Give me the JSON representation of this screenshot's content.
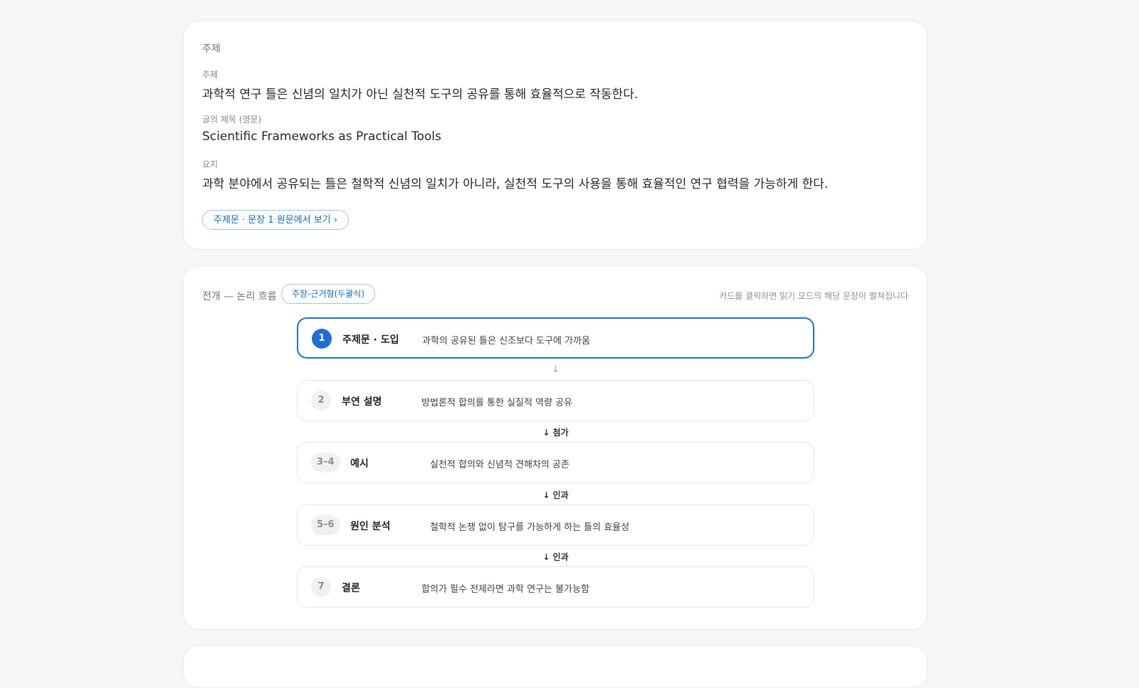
{
  "theme_section": {
    "section_title": "주제",
    "topic_label": "주제",
    "topic_value": "과학적 연구 틀은 신념의 일치가 아닌 실천적 도구의 공유를 통해 효율적으로 작동한다.",
    "title_label": "글의 제목 (영문)",
    "title_value": "Scientific Frameworks as Practical Tools",
    "gist_label": "요지",
    "gist_value": "과학 분야에서 공유되는 틀은 철학적 신념의 일치가 아니라, 실천적 도구의 사용을 통해 효율적인 연구 협력을 가능하게 한다.",
    "view_link": "주제문 · 문장 1 원문에서 보기 ›"
  },
  "flow_section": {
    "section_title": "전개 — 논리 흐름",
    "structure_badge": "주장-근거형(두괄식)",
    "hint": "카드를 클릭하면 읽기 모드의 해당 문장이 펼쳐집니다",
    "steps": [
      {
        "number": "1",
        "name": "주제문 · 도입",
        "summary": "과학의 공유된 틀은 신조보다 도구에 가까움"
      },
      {
        "number": "2",
        "name": "부연 설명",
        "summary": "방법론적 합의를 통한 실질적 역량 공유"
      },
      {
        "number": "3–4",
        "name": "예시",
        "summary": "실천적 합의와 신념적 견해차의 공존"
      },
      {
        "number": "5–6",
        "name": "원인 분석",
        "summary": "철학적 논쟁 없이 탐구를 가능하게 하는 틀의 효율성"
      },
      {
        "number": "7",
        "name": "결론",
        "summary": "합의가 필수 전제라면 과학 연구는 불가능함"
      }
    ],
    "connectors": [
      "↓",
      "↓ 첨가",
      "↓ 인과",
      "↓ 인과"
    ]
  },
  "colors": {
    "accent": "#1f6ed4",
    "link": "#1666c0",
    "background": "#f5f6f7"
  }
}
